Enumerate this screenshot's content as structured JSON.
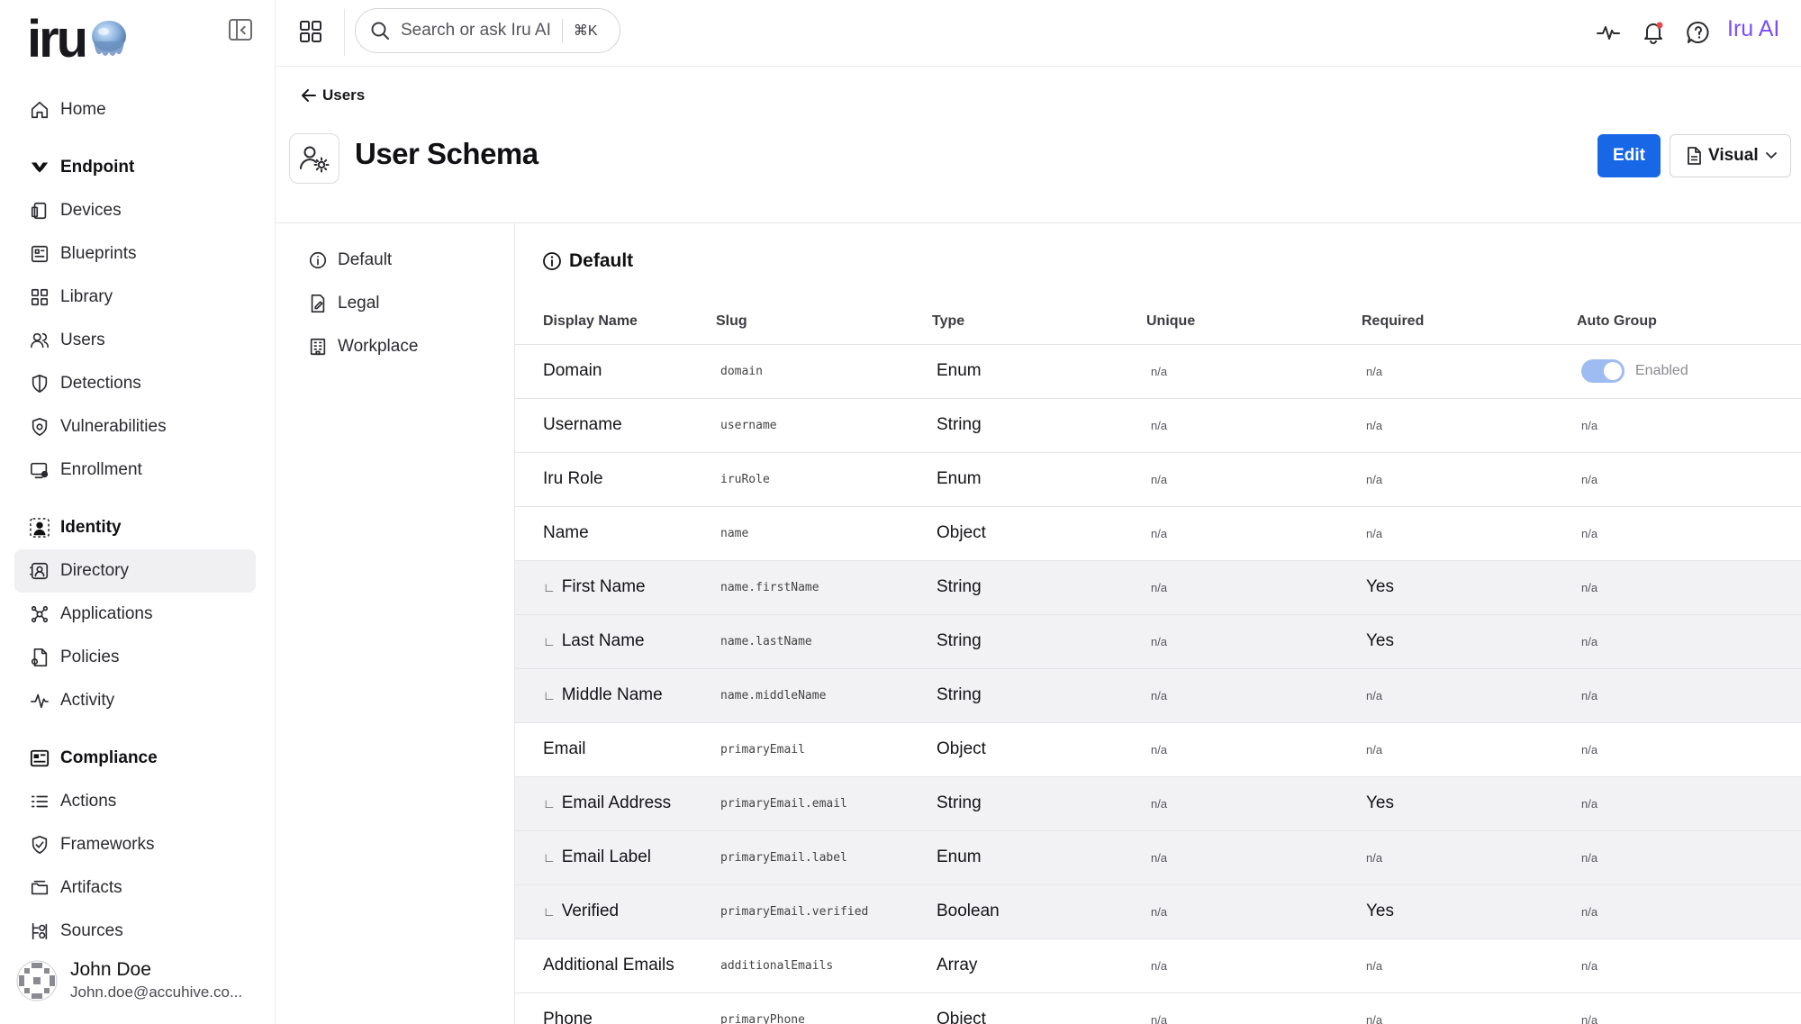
{
  "brand": {
    "logo_text": "iru"
  },
  "sidebar": {
    "groups": [
      {
        "items": [
          {
            "label": "Home",
            "icon": "home-icon"
          }
        ]
      },
      {
        "title": "Endpoint",
        "title_icon": "endpoint-icon",
        "items": [
          {
            "label": "Devices",
            "icon": "devices-icon"
          },
          {
            "label": "Blueprints",
            "icon": "blueprints-icon"
          },
          {
            "label": "Library",
            "icon": "library-icon"
          },
          {
            "label": "Users",
            "icon": "users-icon"
          },
          {
            "label": "Detections",
            "icon": "shield-icon"
          },
          {
            "label": "Vulnerabilities",
            "icon": "vulnerability-icon"
          },
          {
            "label": "Enrollment",
            "icon": "enrollment-icon"
          }
        ]
      },
      {
        "title": "Identity",
        "title_icon": "identity-icon",
        "items": [
          {
            "label": "Directory",
            "icon": "directory-icon",
            "active": true
          },
          {
            "label": "Applications",
            "icon": "applications-icon"
          },
          {
            "label": "Policies",
            "icon": "policies-icon"
          },
          {
            "label": "Activity",
            "icon": "activity-icon"
          }
        ]
      },
      {
        "title": "Compliance",
        "title_icon": "compliance-icon",
        "items": [
          {
            "label": "Actions",
            "icon": "actions-icon"
          },
          {
            "label": "Frameworks",
            "icon": "frameworks-icon"
          },
          {
            "label": "Artifacts",
            "icon": "artifacts-icon"
          },
          {
            "label": "Sources",
            "icon": "sources-icon"
          }
        ]
      }
    ],
    "user": {
      "name": "John Doe",
      "email": "John.doe@accuhive.co..."
    }
  },
  "topbar": {
    "search_placeholder": "Search or ask Iru AI",
    "search_shortcut": "⌘K",
    "ai_label": "Iru AI",
    "ai_color": "#7b4dff"
  },
  "page": {
    "breadcrumb": "Users",
    "title": "User Schema",
    "edit_label": "Edit",
    "view_label": "Visual",
    "primary_color": "#1767e6"
  },
  "sections": [
    {
      "label": "Default",
      "icon": "info-icon"
    },
    {
      "label": "Legal",
      "icon": "legal-icon"
    },
    {
      "label": "Workplace",
      "icon": "workplace-icon"
    }
  ],
  "main": {
    "heading": "Default",
    "columns": [
      "Display Name",
      "Slug",
      "Type",
      "Unique",
      "Required",
      "Auto Group"
    ],
    "rows": [
      {
        "name": "Domain",
        "slug": "domain",
        "type": "Enum",
        "unique": "n/a",
        "required": "n/a",
        "auto_group": "Enabled",
        "auto_toggle": true,
        "child": false
      },
      {
        "name": "Username",
        "slug": "username",
        "type": "String",
        "unique": "n/a",
        "required": "n/a",
        "auto_group": "n/a",
        "child": false
      },
      {
        "name": "Iru Role",
        "slug": "iruRole",
        "type": "Enum",
        "unique": "n/a",
        "required": "n/a",
        "auto_group": "n/a",
        "child": false
      },
      {
        "name": "Name",
        "slug": "name",
        "type": "Object",
        "unique": "n/a",
        "required": "n/a",
        "auto_group": "n/a",
        "child": false
      },
      {
        "name": "First Name",
        "slug": "name.firstName",
        "type": "String",
        "unique": "n/a",
        "required": "Yes",
        "auto_group": "n/a",
        "child": true
      },
      {
        "name": "Last Name",
        "slug": "name.lastName",
        "type": "String",
        "unique": "n/a",
        "required": "Yes",
        "auto_group": "n/a",
        "child": true
      },
      {
        "name": "Middle Name",
        "slug": "name.middleName",
        "type": "String",
        "unique": "n/a",
        "required": "n/a",
        "auto_group": "n/a",
        "child": true
      },
      {
        "name": "Email",
        "slug": "primaryEmail",
        "type": "Object",
        "unique": "n/a",
        "required": "n/a",
        "auto_group": "n/a",
        "child": false
      },
      {
        "name": "Email Address",
        "slug": "primaryEmail.email",
        "type": "String",
        "unique": "n/a",
        "required": "Yes",
        "auto_group": "n/a",
        "child": true
      },
      {
        "name": "Email Label",
        "slug": "primaryEmail.label",
        "type": "Enum",
        "unique": "n/a",
        "required": "n/a",
        "auto_group": "n/a",
        "child": true
      },
      {
        "name": "Verified",
        "slug": "primaryEmail.verified",
        "type": "Boolean",
        "unique": "n/a",
        "required": "Yes",
        "auto_group": "n/a",
        "child": true
      },
      {
        "name": "Additional Emails",
        "slug": "additionalEmails",
        "type": "Array",
        "unique": "n/a",
        "required": "n/a",
        "auto_group": "n/a",
        "child": false
      },
      {
        "name": "Phone",
        "slug": "primaryPhone",
        "type": "Object",
        "unique": "n/a",
        "required": "n/a",
        "auto_group": "n/a",
        "child": false
      }
    ]
  }
}
